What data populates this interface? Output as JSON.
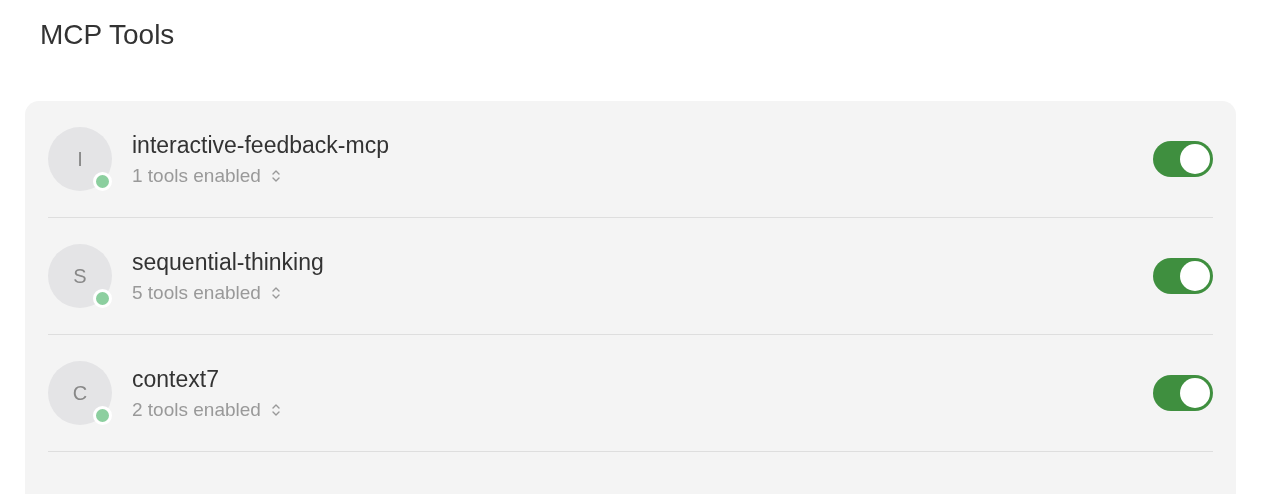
{
  "title": "MCP Tools",
  "servers": [
    {
      "initial": "I",
      "name": "interactive-feedback-mcp",
      "tools": "1 tools enabled",
      "online": true,
      "on": true
    },
    {
      "initial": "S",
      "name": "sequential-thinking",
      "tools": "5 tools enabled",
      "online": true,
      "on": true
    },
    {
      "initial": "C",
      "name": "context7",
      "tools": "2 tools enabled",
      "online": true,
      "on": true
    }
  ]
}
